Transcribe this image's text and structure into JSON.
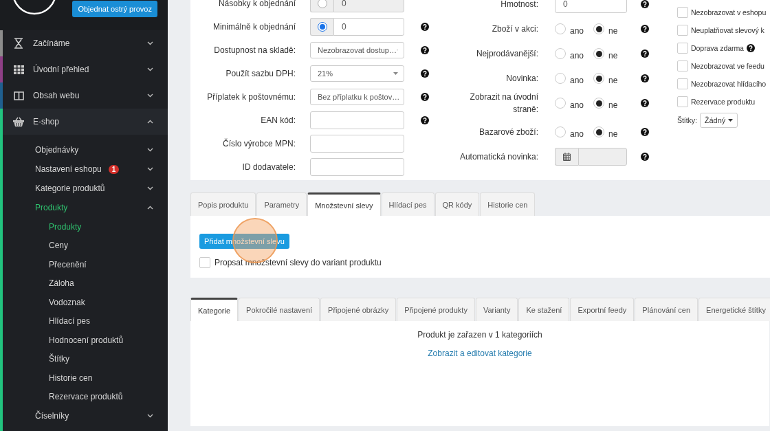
{
  "sidebar": {
    "order_button": "Objednat ostrý provoz",
    "items": [
      {
        "label": "Začínáme",
        "color": "#8c8c8c",
        "expanded": false
      },
      {
        "label": "Úvodní přehled",
        "color": "#8e3f86",
        "expanded": false
      },
      {
        "label": "Obsah webu",
        "color": "#1f5f8f",
        "expanded": false
      },
      {
        "label": "E-shop",
        "color": "#22c37f",
        "expanded": true,
        "children": [
          {
            "label": "Objednávky",
            "expanded": false,
            "selected": false
          },
          {
            "label": "Nastavení eshopu",
            "badge": "1",
            "expanded": false,
            "selected": false
          },
          {
            "label": "Kategorie produktů",
            "expanded": false,
            "selected": false
          },
          {
            "label": "Produkty",
            "expanded": true,
            "selected": true,
            "children": [
              {
                "label": "Produkty",
                "selected": true
              },
              {
                "label": "Ceny",
                "selected": false
              },
              {
                "label": "Přecenění",
                "selected": false
              },
              {
                "label": "Záloha",
                "selected": false
              },
              {
                "label": "Vodoznak",
                "selected": false
              },
              {
                "label": "Hlídací pes",
                "selected": false
              },
              {
                "label": "Hodnocení produktů",
                "selected": false
              },
              {
                "label": "Štítky",
                "selected": false
              },
              {
                "label": "Historie cen",
                "selected": false
              },
              {
                "label": "Rezervace produktů",
                "selected": false
              }
            ]
          },
          {
            "label": "Číselníky",
            "expanded": false,
            "selected": false
          }
        ]
      }
    ]
  },
  "form": {
    "left": [
      {
        "kind": "radio-input",
        "label": "Násobky k objednání",
        "selected": false,
        "value": "0",
        "help": false
      },
      {
        "kind": "radio-input",
        "label": "Minimálně k objednání",
        "selected": true,
        "value": "0",
        "help": true
      },
      {
        "kind": "select",
        "label": "Dostupnost na skladě:",
        "value": "Nezobrazovat dostup…",
        "help": true
      },
      {
        "kind": "select",
        "label": "Použít sazbu DPH:",
        "value": "21%",
        "help": true
      },
      {
        "kind": "select",
        "label": "Příplatek k poštovnému:",
        "value": "Bez příplatku k poštov…",
        "help": true
      },
      {
        "kind": "text",
        "label": "EAN kód:",
        "help": true
      },
      {
        "kind": "text",
        "label": "Číslo výrobce MPN:",
        "help": false
      },
      {
        "kind": "text",
        "label": "ID dodavatele:",
        "help": false
      }
    ],
    "middle": [
      {
        "kind": "text",
        "label": "Hmotnost:",
        "value": "0",
        "help": true
      },
      {
        "kind": "radio-group",
        "label": "Zboží v akci:",
        "options": [
          {
            "label": "ano",
            "selected": false
          },
          {
            "label": "ne",
            "selected": true
          }
        ],
        "help": true
      },
      {
        "kind": "radio-group",
        "label": "Nejprodávanější:",
        "options": [
          {
            "label": "ano",
            "selected": false
          },
          {
            "label": "ne",
            "selected": true
          }
        ],
        "help": true
      },
      {
        "kind": "radio-group",
        "label": "Novinka:",
        "options": [
          {
            "label": "ano",
            "selected": false
          },
          {
            "label": "ne",
            "selected": true
          }
        ],
        "help": true
      },
      {
        "kind": "radio-group",
        "label": "Zobrazit na úvodní straně:",
        "options": [
          {
            "label": "ano",
            "selected": false
          },
          {
            "label": "ne",
            "selected": true
          }
        ],
        "help": true
      },
      {
        "kind": "radio-group",
        "label": "Bazarové zboží:",
        "options": [
          {
            "label": "ano",
            "selected": false
          },
          {
            "label": "ne",
            "selected": true
          }
        ],
        "help": true
      },
      {
        "kind": "date",
        "label": "Automatická novinka:",
        "disabled": true,
        "help": true
      }
    ],
    "right": {
      "checkboxes": [
        {
          "label": "Nezobrazovat v eshopu",
          "checked": false,
          "help": false
        },
        {
          "label": "Neuplatňovat slevový k",
          "checked": false,
          "help": false
        },
        {
          "label": "Doprava zdarma",
          "checked": false,
          "help": true
        },
        {
          "label": "Nezobrazovat ve feedu",
          "checked": false,
          "help": false
        },
        {
          "label": "Nezobrazovat hlídacího",
          "checked": false,
          "help": false
        },
        {
          "label": "Rezervace produktu",
          "checked": false,
          "help": false
        }
      ],
      "tags_label": "Štítky:",
      "tags_value": "Žádný"
    }
  },
  "detail_tabs": {
    "tabs": [
      {
        "label": "Popis produktu",
        "selected": false
      },
      {
        "label": "Parametry",
        "selected": false
      },
      {
        "label": "Množstevní slevy",
        "selected": true
      },
      {
        "label": "Hlídací pes",
        "selected": false
      },
      {
        "label": "QR kódy",
        "selected": false
      },
      {
        "label": "Historie cen",
        "selected": false
      }
    ],
    "add_button": "Přidat množstevní slevu",
    "propagate_checkbox": {
      "label": "Propsat množstevní slevy do variant produktu",
      "checked": false
    }
  },
  "category_tabs": {
    "tabs": [
      {
        "label": "Kategorie",
        "selected": true
      },
      {
        "label": "Pokročilé nastavení",
        "selected": false
      },
      {
        "label": "Připojené obrázky",
        "selected": false
      },
      {
        "label": "Připojené produkty",
        "selected": false
      },
      {
        "label": "Varianty",
        "selected": false
      },
      {
        "label": "Ke stažení",
        "selected": false
      },
      {
        "label": "Exportní feedy",
        "selected": false
      },
      {
        "label": "Plánování cen",
        "selected": false
      },
      {
        "label": "Energetické štítky",
        "selected": false
      }
    ],
    "message": "Produkt je zařazen v 1 kategoriích",
    "link": "Zobrazit a editovat kategorie"
  }
}
